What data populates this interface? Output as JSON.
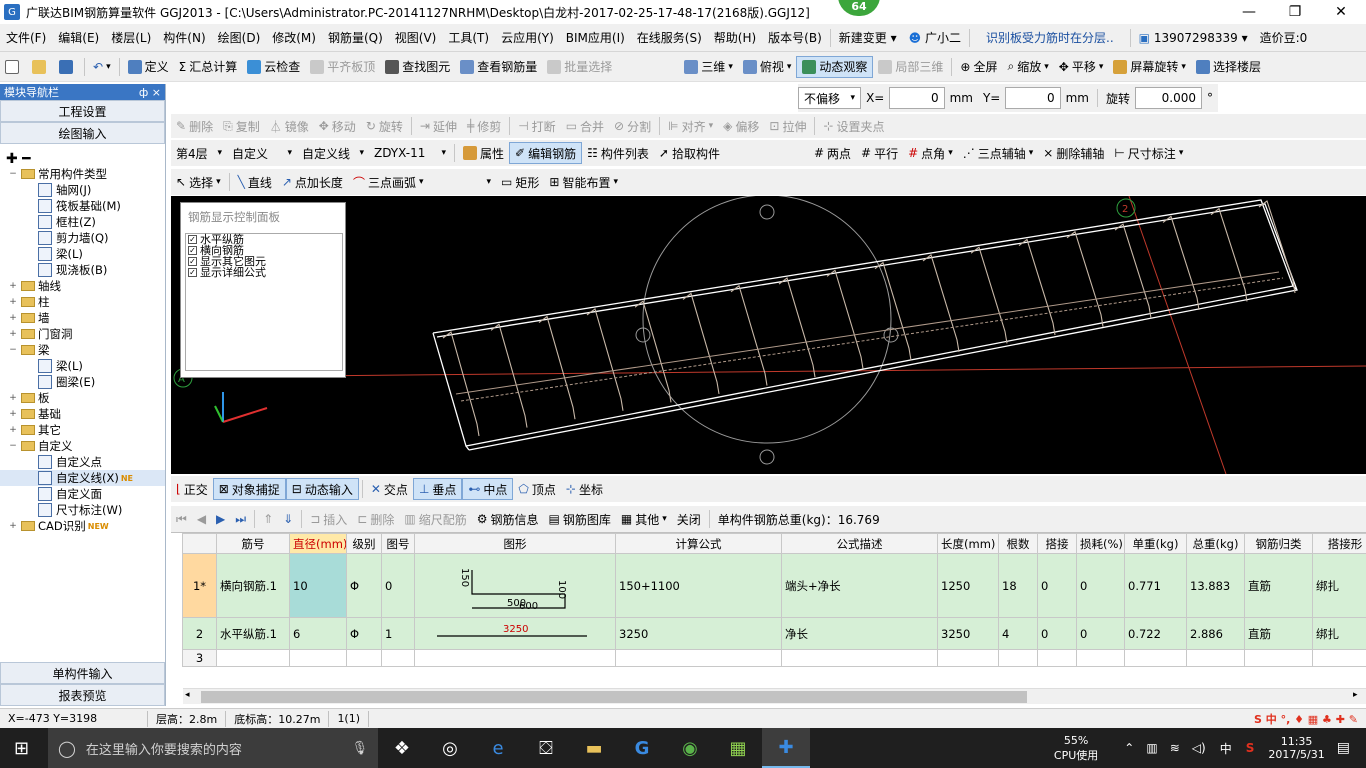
{
  "window": {
    "title": "广联达BIM钢筋算量软件 GGJ2013 - [C:\\Users\\Administrator.PC-20141127NRHM\\Desktop\\白龙村-2017-02-25-17-48-17(2168版).GGJ12]",
    "badge": "64",
    "min": "—",
    "max": "❐",
    "close": "✕"
  },
  "menu": {
    "items": [
      "文件(F)",
      "编辑(E)",
      "楼层(L)",
      "构件(N)",
      "绘图(D)",
      "修改(M)",
      "钢筋量(Q)",
      "视图(V)",
      "工具(T)",
      "云应用(Y)",
      "BIM应用(I)",
      "在线服务(S)",
      "帮助(H)",
      "版本号(B)"
    ],
    "new_change": "新建变更",
    "assistant": "广小二",
    "hint": "识别板受力筋时在分层..",
    "phone": "13907298339",
    "cost_bean": "造价豆:0"
  },
  "toolbar1": {
    "define": "定义",
    "sum_calc": "汇总计算",
    "cloud_check": "云检查",
    "flat_top": "平齐板顶",
    "find_element": "查找图元",
    "view_rebar": "查看钢筋量",
    "batch_select": "批量选择",
    "view_3d": "三维",
    "top_view": "俯视",
    "dynamic_view": "动态观察",
    "partial_3d": "局部三维",
    "fullscreen": "全屏",
    "zoom": "缩放",
    "pan": "平移",
    "rotate_screen": "屏幕旋转",
    "select_floor": "选择楼层"
  },
  "nav": {
    "header": "模块导航栏",
    "pin": "ф ×",
    "project_settings": "工程设置",
    "drawing_input": "绘图输入",
    "single_input": "单构件输入",
    "report_preview": "报表预览",
    "tree": [
      {
        "label": "常用构件类型",
        "level": 0,
        "toggle": "−",
        "folder": true
      },
      {
        "label": "轴网(J)",
        "level": 1
      },
      {
        "label": "筏板基础(M)",
        "level": 1
      },
      {
        "label": "框柱(Z)",
        "level": 1
      },
      {
        "label": "剪力墙(Q)",
        "level": 1
      },
      {
        "label": "梁(L)",
        "level": 1
      },
      {
        "label": "现浇板(B)",
        "level": 1
      },
      {
        "label": "轴线",
        "level": 0,
        "toggle": "+",
        "folder": true
      },
      {
        "label": "柱",
        "level": 0,
        "toggle": "+",
        "folder": true
      },
      {
        "label": "墙",
        "level": 0,
        "toggle": "+",
        "folder": true
      },
      {
        "label": "门窗洞",
        "level": 0,
        "toggle": "+",
        "folder": true
      },
      {
        "label": "梁",
        "level": 0,
        "toggle": "−",
        "folder": true
      },
      {
        "label": "梁(L)",
        "level": 1
      },
      {
        "label": "圈梁(E)",
        "level": 1
      },
      {
        "label": "板",
        "level": 0,
        "toggle": "+",
        "folder": true
      },
      {
        "label": "基础",
        "level": 0,
        "toggle": "+",
        "folder": true
      },
      {
        "label": "其它",
        "level": 0,
        "toggle": "+",
        "folder": true
      },
      {
        "label": "自定义",
        "level": 0,
        "toggle": "−",
        "folder": true
      },
      {
        "label": "自定义点",
        "level": 1
      },
      {
        "label": "自定义线(X)",
        "level": 1,
        "selected": true,
        "new": "NE"
      },
      {
        "label": "自定义面",
        "level": 1
      },
      {
        "label": "尺寸标注(W)",
        "level": 1
      },
      {
        "label": "CAD识别",
        "level": 0,
        "toggle": "+",
        "folder": true,
        "new": "NEW"
      }
    ]
  },
  "offset_bar": {
    "mode": "不偏移",
    "x_label": "X=",
    "x_value": "0",
    "mm1": "mm",
    "y_label": "Y=",
    "y_value": "0",
    "mm2": "mm",
    "rotate": "旋转",
    "rotate_value": "0.000",
    "deg": "°"
  },
  "edit_bar": {
    "delete": "删除",
    "copy": "复制",
    "mirror": "镜像",
    "move": "移动",
    "rotate": "旋转",
    "extend": "延伸",
    "trim": "修剪",
    "break": "打断",
    "merge": "合并",
    "split": "分割",
    "align": "对齐",
    "offset": "偏移",
    "stretch": "拉伸",
    "set_grip": "设置夹点"
  },
  "layer_bar": {
    "floor": "第4层",
    "category": "自定义",
    "type": "自定义线",
    "name": "ZDYX-11",
    "props": "属性",
    "edit_rebar": "编辑钢筋",
    "element_list": "构件列表",
    "pick_element": "拾取构件",
    "two_points": "两点",
    "parallel": "平行",
    "point_angle": "点角",
    "three_point_aux": "三点辅轴",
    "delete_aux": "删除辅轴",
    "dim": "尺寸标注"
  },
  "draw_bar": {
    "select": "选择",
    "line": "直线",
    "point_len": "点加长度",
    "arc": "三点画弧",
    "rect": "矩形",
    "smart": "智能布置"
  },
  "panel": {
    "title": "钢筋显示控制面板",
    "options": [
      {
        "label": "水平纵筋",
        "checked": "✓"
      },
      {
        "label": "横向钢筋",
        "checked": "✓"
      },
      {
        "label": "显示其它图元",
        "checked": "✓"
      },
      {
        "label": "显示详细公式",
        "checked": "✓"
      }
    ]
  },
  "canvas": {
    "axis_a": "A",
    "axis_2": "2"
  },
  "snap_bar": {
    "ortho": "正交",
    "obj_snap": "对象捕捉",
    "dyn_input": "动态输入",
    "intersect": "交点",
    "perp": "垂点",
    "mid": "中点",
    "vertex": "顶点",
    "coord": "坐标"
  },
  "grid_bar": {
    "insert": "插入",
    "delete": "删除",
    "scale": "缩尺配筋",
    "rebar_info": "钢筋信息",
    "rebar_lib": "钢筋图库",
    "other": "其他",
    "close": "关闭",
    "total": "单构件钢筋总重(kg)：16.769"
  },
  "grid": {
    "headers": [
      "",
      "筋号",
      "直径(mm)",
      "级别",
      "图号",
      "图形",
      "计算公式",
      "公式描述",
      "长度(mm)",
      "根数",
      "搭接",
      "损耗(%)",
      "单重(kg)",
      "总重(kg)",
      "钢筋归类",
      "搭接形"
    ],
    "rows": [
      [
        "1*",
        "横向钢筋.1",
        "10",
        "Φ",
        "0",
        "",
        "150+1100",
        "端头+净长",
        "1250",
        "18",
        "0",
        "0",
        "0.771",
        "13.883",
        "直筋",
        "绑扎"
      ],
      [
        "2",
        "水平纵筋.1",
        "6",
        "Φ",
        "1",
        "",
        "3250",
        "净长",
        "3250",
        "4",
        "0",
        "0",
        "0.722",
        "2.886",
        "直筋",
        "绑扎"
      ],
      [
        "3",
        "",
        "",
        "",
        "",
        "",
        "",
        "",
        "",
        "",
        "",
        "",
        "",
        "",
        "",
        ""
      ]
    ],
    "shape1": {
      "top": "150",
      "right": "100",
      "bottom": "500",
      "bottom2": "600"
    },
    "shape2": {
      "len": "3250"
    }
  },
  "status": {
    "coords": "X=-473 Y=3198",
    "floor_h": "层高：2.8m",
    "base_h": "底标高：10.27m",
    "count": "1(1)"
  },
  "taskbar": {
    "search": "在这里输入你要搜索的内容",
    "cpu": "55%",
    "cpu_label": "CPU使用",
    "ime": "中",
    "time": "11:35",
    "date": "2017/5/31"
  },
  "colors": {
    "accent": "#3a76c4",
    "canvas_bg": "#000000",
    "row_fill": "#d6efd6",
    "highlight": "#a8dcd8"
  }
}
